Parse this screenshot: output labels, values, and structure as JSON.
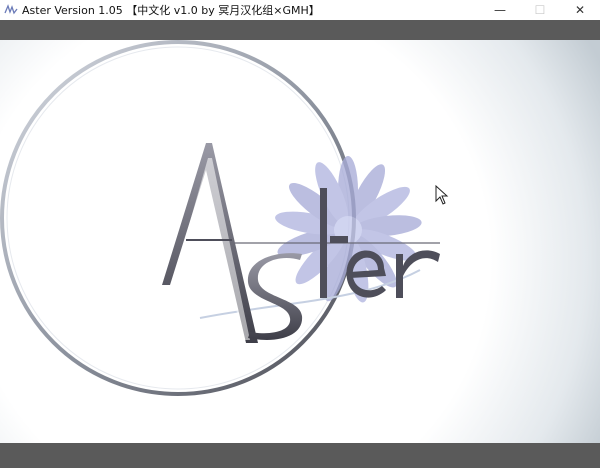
{
  "window": {
    "title": "Aster Version 1.05 【中文化 v1.0 by 冥月汉化组×GMH】",
    "controls": {
      "minimize": "—",
      "maximize": "☐",
      "close": "✕"
    }
  },
  "logo": {
    "text": "Aster",
    "icon": "aster-flower-logo"
  },
  "colors": {
    "chrome_bar": "#5a5a5a",
    "logo_dark": "#4e4e5a",
    "flower": "#a8acd8",
    "vignette": "#c3ccd3"
  }
}
